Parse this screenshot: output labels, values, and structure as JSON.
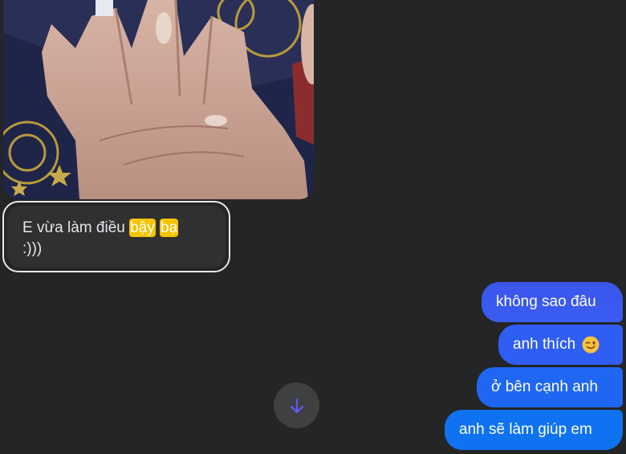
{
  "incoming": {
    "text_before": "E vừa làm điều ",
    "highlight_1": "bậy",
    "highlight_2": "bạ",
    "text_after": ":)))"
  },
  "outgoing": [
    {
      "text": "không sao đâu"
    },
    {
      "text": "anh thích",
      "emoji": "wink-emoji"
    },
    {
      "text": "ở bên cạnh anh"
    },
    {
      "text": "anh sẽ làm giúp em"
    }
  ],
  "colors": {
    "background": "#242526",
    "incoming_bubble": "#303030",
    "outgoing_bubble": "#0f72f0",
    "highlight": "#f5c400"
  },
  "icons": {
    "scroll_down": "arrow-down-icon"
  }
}
